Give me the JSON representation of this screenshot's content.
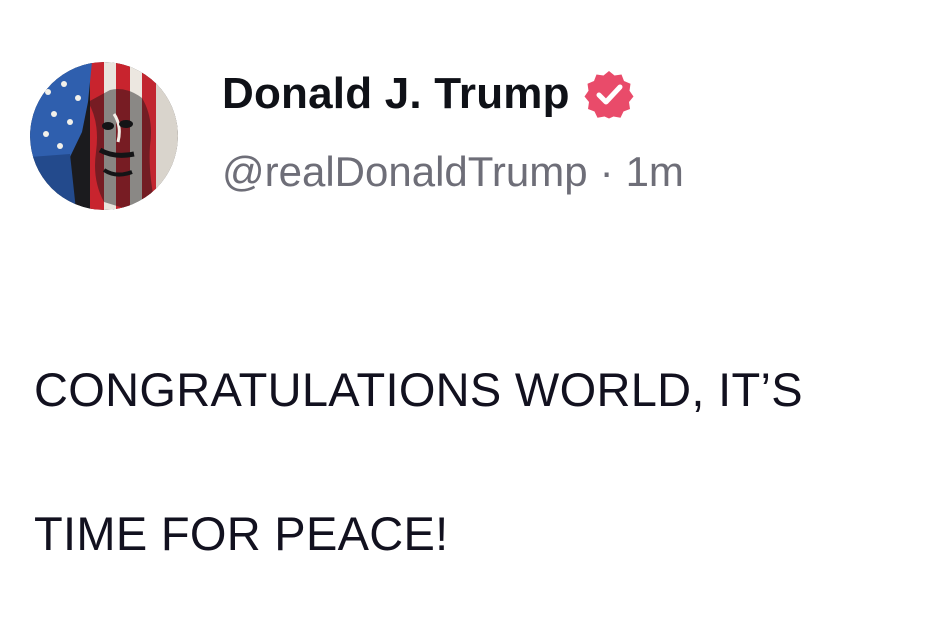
{
  "post": {
    "author": {
      "display_name": "Donald J. Trump",
      "handle": "@realDonaldTrump",
      "verified": true,
      "avatar_icon": "avatar-flag-portrait-icon"
    },
    "separator": "·",
    "timestamp": "1m",
    "body_lines": [
      "CONGRATULATIONS WORLD, IT’S",
      "TIME FOR PEACE!"
    ]
  },
  "colors": {
    "verified_badge": "#e94b6a",
    "name_text": "#0f1117",
    "secondary_text": "#6e6e78",
    "body_text": "#12111f"
  }
}
